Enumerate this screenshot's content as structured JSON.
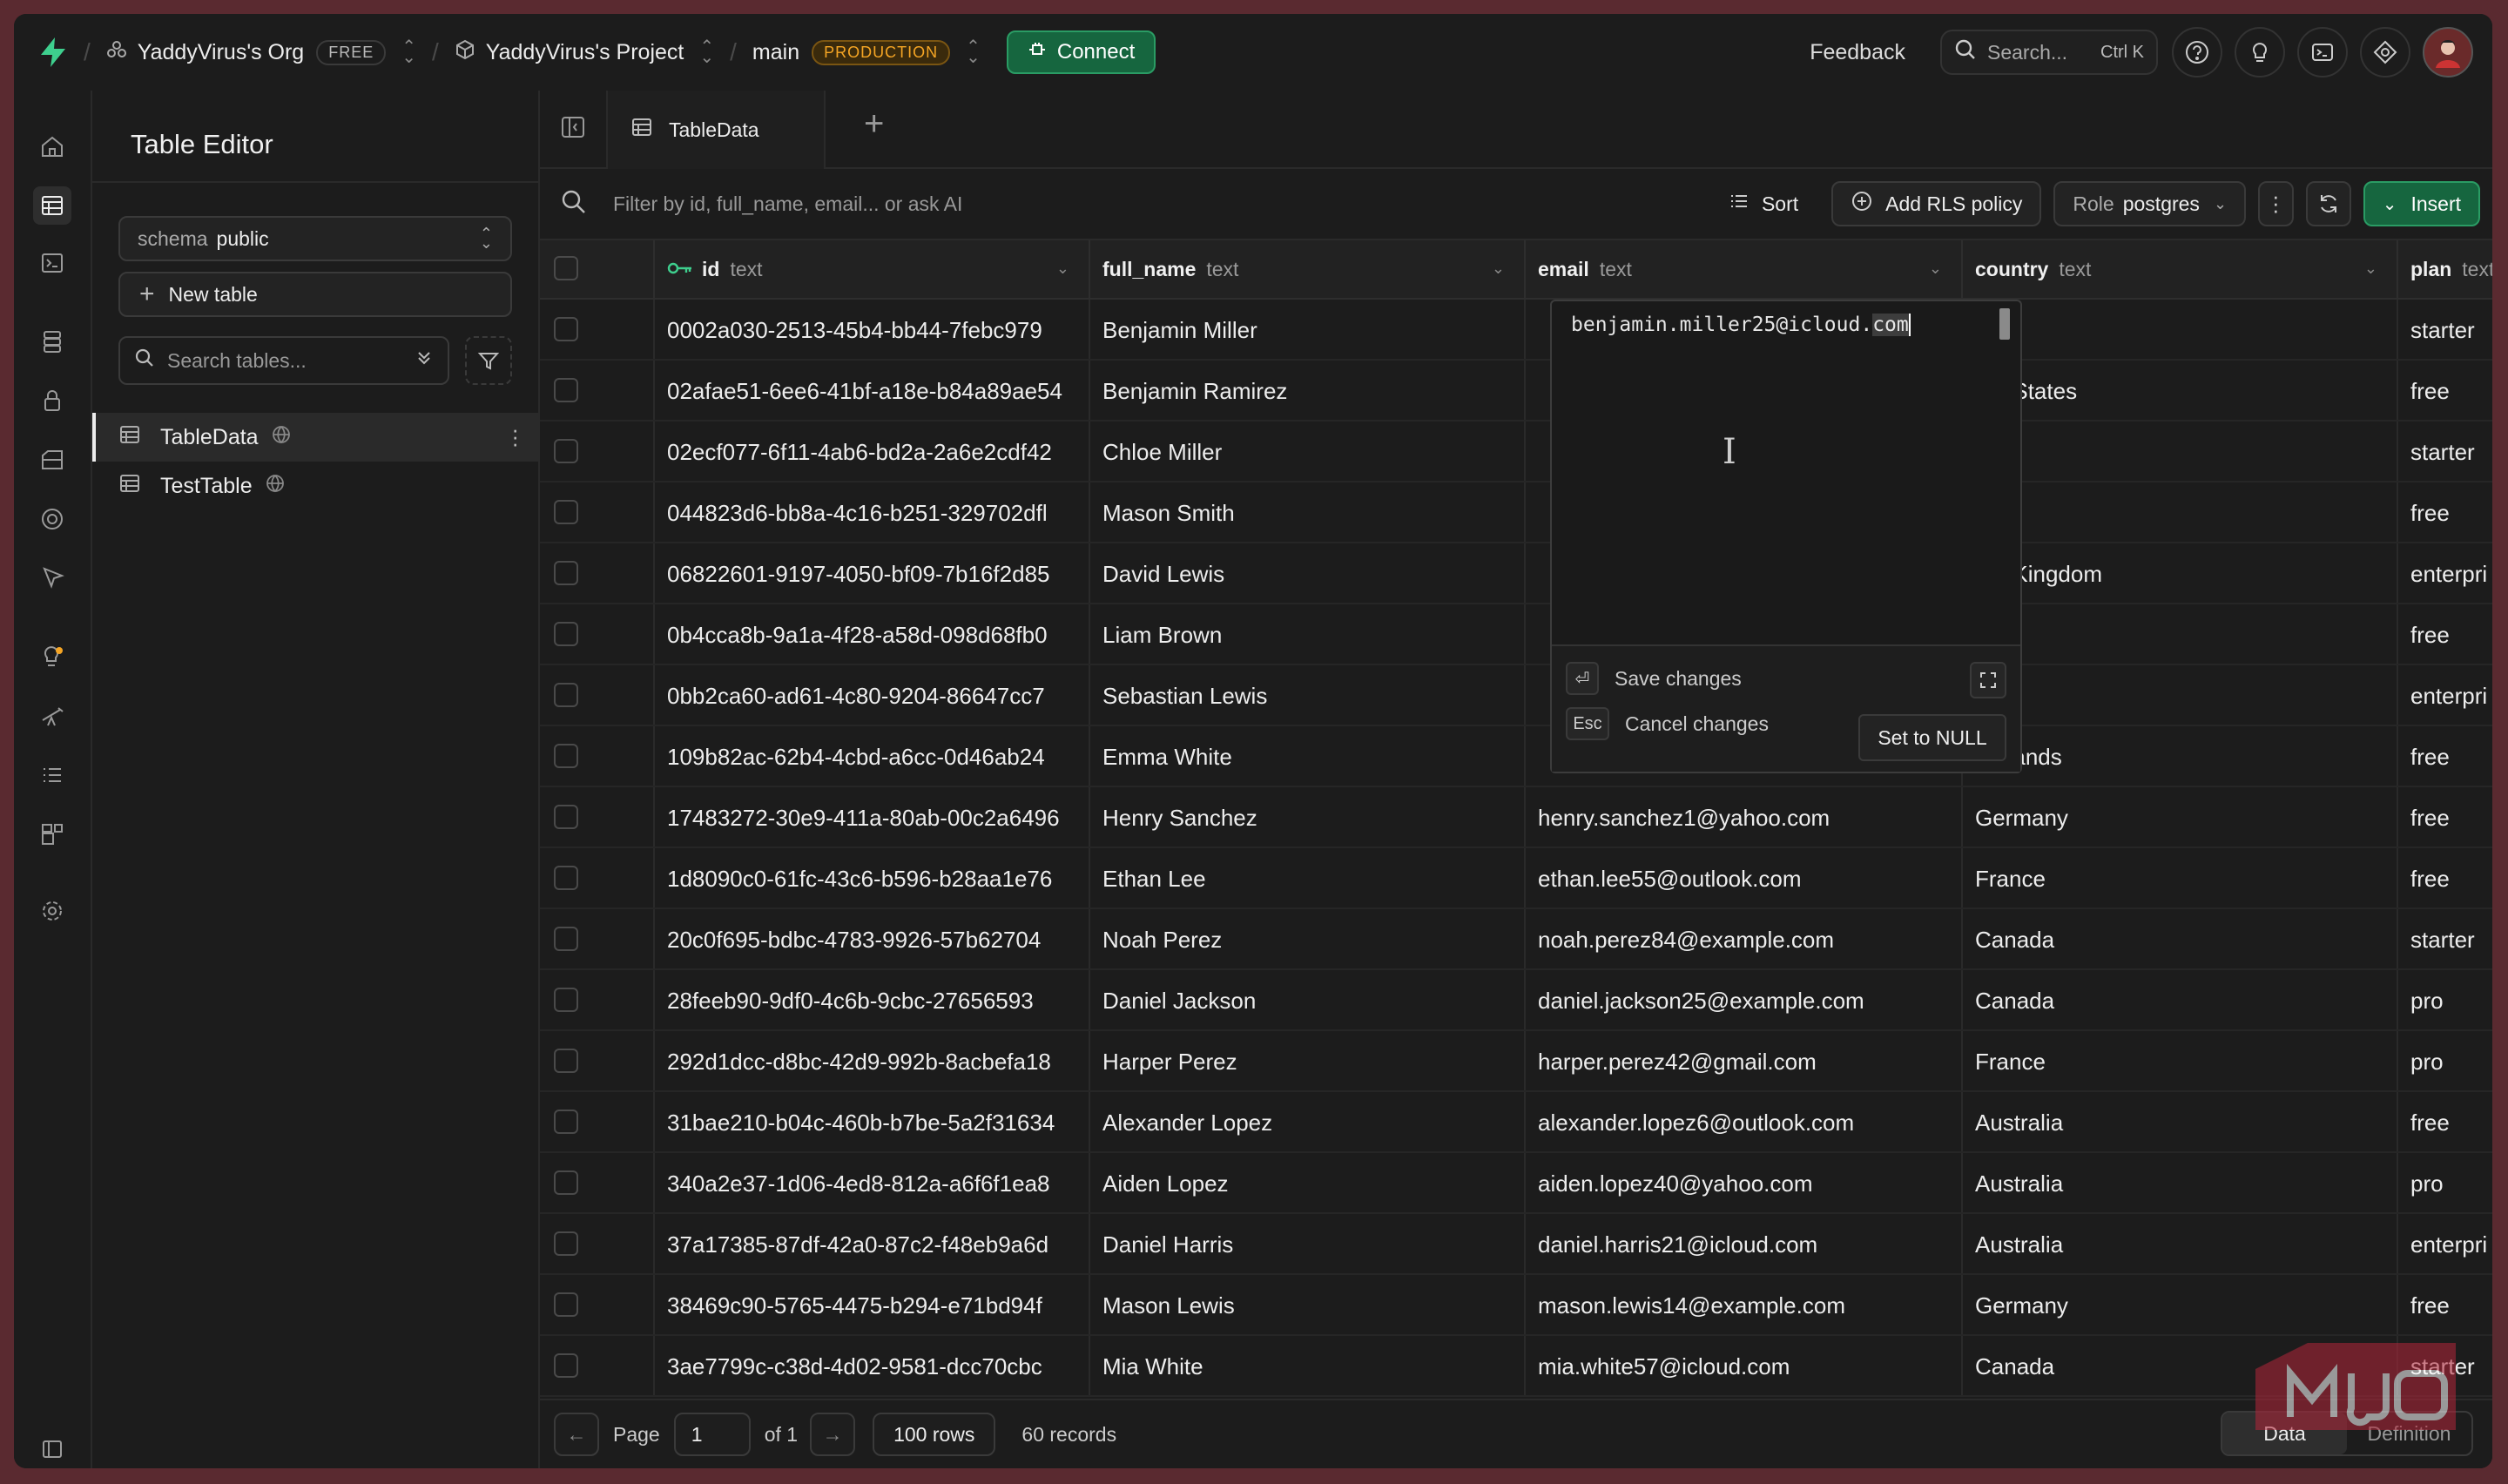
{
  "topbar": {
    "org_name": "YaddyVirus's Org",
    "org_plan": "FREE",
    "project_name": "YaddyVirus's Project",
    "branch_name": "main",
    "branch_env": "PRODUCTION",
    "connect_label": "Connect",
    "feedback_label": "Feedback",
    "search_placeholder": "Search...",
    "search_shortcut": "Ctrl K"
  },
  "side": {
    "title": "Table Editor",
    "schema_prefix": "schema",
    "schema_value": "public",
    "new_table_label": "New table",
    "search_placeholder": "Search tables...",
    "tables": [
      {
        "name": "TableData"
      },
      {
        "name": "TestTable"
      }
    ]
  },
  "main": {
    "tab_label": "TableData",
    "filter_placeholder": "Filter by id, full_name, email... or ask AI",
    "sort_label": "Sort",
    "rls_label": "Add RLS policy",
    "role_prefix": "Role",
    "role_value": "postgres",
    "insert_label": "Insert"
  },
  "columns": [
    {
      "name": "id",
      "type": "text"
    },
    {
      "name": "full_name",
      "type": "text"
    },
    {
      "name": "email",
      "type": "text"
    },
    {
      "name": "country",
      "type": "text"
    },
    {
      "name": "plan",
      "type": "text"
    }
  ],
  "rows": [
    {
      "id": "0002a030-2513-45b4-bb44-7febc979",
      "full_name": "Benjamin Miller",
      "email": "",
      "country": "zil",
      "plan": "starter"
    },
    {
      "id": "02afae51-6ee6-41bf-a18e-b84a89ae54",
      "full_name": "Benjamin Ramirez",
      "email": "",
      "country": "ted States",
      "plan": "free"
    },
    {
      "id": "02ecf077-6f11-4ab6-bd2a-2a6e2cdf42",
      "full_name": "Chloe Miller",
      "email": "",
      "country": "zil",
      "plan": "starter"
    },
    {
      "id": "044823d6-bb8a-4c16-b251-329702dfl",
      "full_name": "Mason Smith",
      "email": "",
      "country": "pan",
      "plan": "free"
    },
    {
      "id": "06822601-9197-4050-bf09-7b16f2d85",
      "full_name": "David Lewis",
      "email": "",
      "country": "ted Kingdom",
      "plan": "enterpri"
    },
    {
      "id": "0b4cca8b-9a1a-4f28-a58d-098d68fb0",
      "full_name": "Liam Brown",
      "email": "",
      "country": "ia",
      "plan": "free"
    },
    {
      "id": "0bb2ca60-ad61-4c80-9204-86647cc7",
      "full_name": "Sebastian Lewis",
      "email": "",
      "country": "pan",
      "plan": "enterpri"
    },
    {
      "id": "109b82ac-62b4-4cbd-a6cc-0d46ab24",
      "full_name": "Emma White",
      "email": "",
      "country": "herlands",
      "plan": "free"
    },
    {
      "id": "17483272-30e9-411a-80ab-00c2a6496",
      "full_name": "Henry Sanchez",
      "email": "henry.sanchez1@yahoo.com",
      "country": "Germany",
      "plan": "free"
    },
    {
      "id": "1d8090c0-61fc-43c6-b596-b28aa1e76",
      "full_name": "Ethan Lee",
      "email": "ethan.lee55@outlook.com",
      "country": "France",
      "plan": "free"
    },
    {
      "id": "20c0f695-bdbc-4783-9926-57b62704",
      "full_name": "Noah Perez",
      "email": "noah.perez84@example.com",
      "country": "Canada",
      "plan": "starter"
    },
    {
      "id": "28feeb90-9df0-4c6b-9cbc-27656593",
      "full_name": "Daniel Jackson",
      "email": "daniel.jackson25@example.com",
      "country": "Canada",
      "plan": "pro"
    },
    {
      "id": "292d1dcc-d8bc-42d9-992b-8acbefa18",
      "full_name": "Harper Perez",
      "email": "harper.perez42@gmail.com",
      "country": "France",
      "plan": "pro"
    },
    {
      "id": "31bae210-b04c-460b-b7be-5a2f31634",
      "full_name": "Alexander Lopez",
      "email": "alexander.lopez6@outlook.com",
      "country": "Australia",
      "plan": "free"
    },
    {
      "id": "340a2e37-1d06-4ed8-812a-a6f6f1ea8",
      "full_name": "Aiden Lopez",
      "email": "aiden.lopez40@yahoo.com",
      "country": "Australia",
      "plan": "pro"
    },
    {
      "id": "37a17385-87df-42a0-87c2-f48eb9a6d",
      "full_name": "Daniel Harris",
      "email": "daniel.harris21@icloud.com",
      "country": "Australia",
      "plan": "enterpri"
    },
    {
      "id": "38469c90-5765-4475-b294-e71bd94f",
      "full_name": "Mason Lewis",
      "email": "mason.lewis14@example.com",
      "country": "Germany",
      "plan": "free"
    },
    {
      "id": "3ae7799c-c38d-4d02-9581-dcc70cbc",
      "full_name": "Mia White",
      "email": "mia.white57@icloud.com",
      "country": "Canada",
      "plan": "starter"
    }
  ],
  "editor": {
    "value_main": "benjamin.miller25@icloud.",
    "value_selected": "com",
    "save_label": "Save changes",
    "esc_key": "Esc",
    "cancel_label": "Cancel changes",
    "null_label": "Set to NULL"
  },
  "footer": {
    "page_label": "Page",
    "page_value": "1",
    "of_label": "of 1",
    "rows_label": "100 rows",
    "records_label": "60 records",
    "data_label": "Data",
    "definition_label": "Definition"
  },
  "colors": {
    "brand_green": "#3ecf8e",
    "connect_green": "#16663f",
    "production_amber": "#f5a524"
  }
}
